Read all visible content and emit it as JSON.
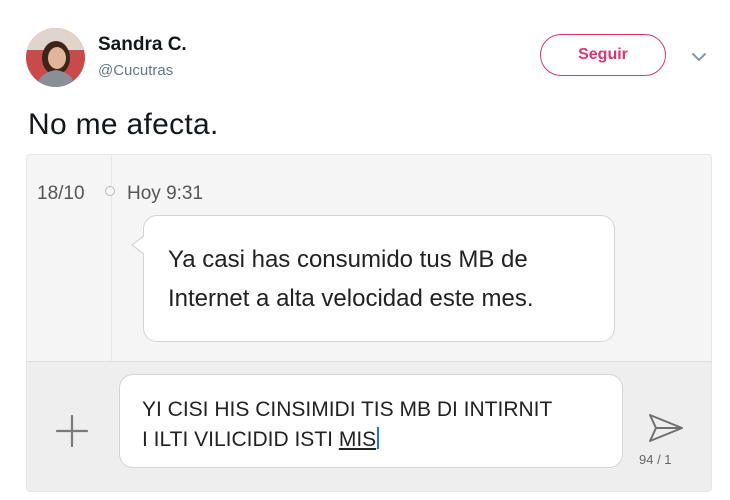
{
  "author": {
    "name": "Sandra C.",
    "handle": "@Cucutras"
  },
  "follow_label": "Seguir",
  "tweet_text": "No me afecta.",
  "screenshot": {
    "date": "18/10",
    "time": "Hoy 9:31",
    "message_line1": "Ya casi has consumido tus MB de",
    "message_line2": "Internet a alta velocidad este mes.",
    "input_line1": "YI CISI HIS CINSIMIDI TIS MB DI INTIRNIT",
    "input_line2_prefix": "I ILTI VILICIDID ISTI ",
    "input_line2_underlined": "MIS",
    "counter": "94 / 1"
  },
  "colors": {
    "accent": "#d9366e",
    "handle_gray": "#657786",
    "bubble_border": "#d4d4d4"
  },
  "icons": [
    "avatar",
    "chevron-down-icon",
    "plus-icon",
    "send-icon"
  ]
}
